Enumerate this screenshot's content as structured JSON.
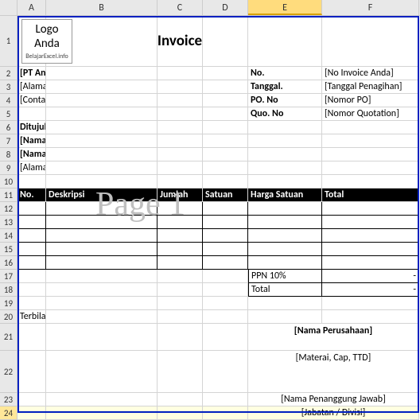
{
  "cols": [
    "A",
    "B",
    "C",
    "D",
    "E",
    "F"
  ],
  "rows": [
    "1",
    "2",
    "3",
    "4",
    "5",
    "6",
    "7",
    "8",
    "9",
    "10",
    "11",
    "12",
    "13",
    "14",
    "15",
    "16",
    "17",
    "18",
    "19",
    "20",
    "21",
    "22",
    "23",
    "24"
  ],
  "logo": {
    "line1": "Logo",
    "line2": "Anda",
    "sub": "BelajarExcel.info"
  },
  "title": "Invoice",
  "sender": {
    "company": "[PT Anda]",
    "address": "[Alamat]",
    "contact": "[Contact]"
  },
  "meta": {
    "no_label": "No.",
    "no_val": "[No Invoice Anda]",
    "date_label": "Tanggal.",
    "date_val": "[Tanggal Penagihan]",
    "po_label": "PO. No",
    "po_val": "[Nomor PO]",
    "quo_label": "Quo. No",
    "quo_val": "[Nomor Quotation]"
  },
  "recipient": {
    "heading": "Ditujukan Kepada:",
    "name": "[Nama Orang Yang Dituju]",
    "company": "[Nama Perusahaan]",
    "address": "[Alamat]"
  },
  "thead": {
    "no": "No.",
    "desc": "Deskripsi",
    "qty": "Jumlah",
    "unit": "Satuan",
    "price": "Harga Satuan",
    "total": "Total"
  },
  "summary": {
    "ppn": "PPN 10%",
    "total": "Total",
    "dash": "-"
  },
  "terbilang": "Terbilang :",
  "sign": {
    "company": "[Nama Perusahaan]",
    "stamp": "[Materai, Cap, TTD]",
    "person": "[Nama Penanggung Jawab]",
    "title": "[Jabatan / Divisi]"
  },
  "watermark": "Page 1"
}
